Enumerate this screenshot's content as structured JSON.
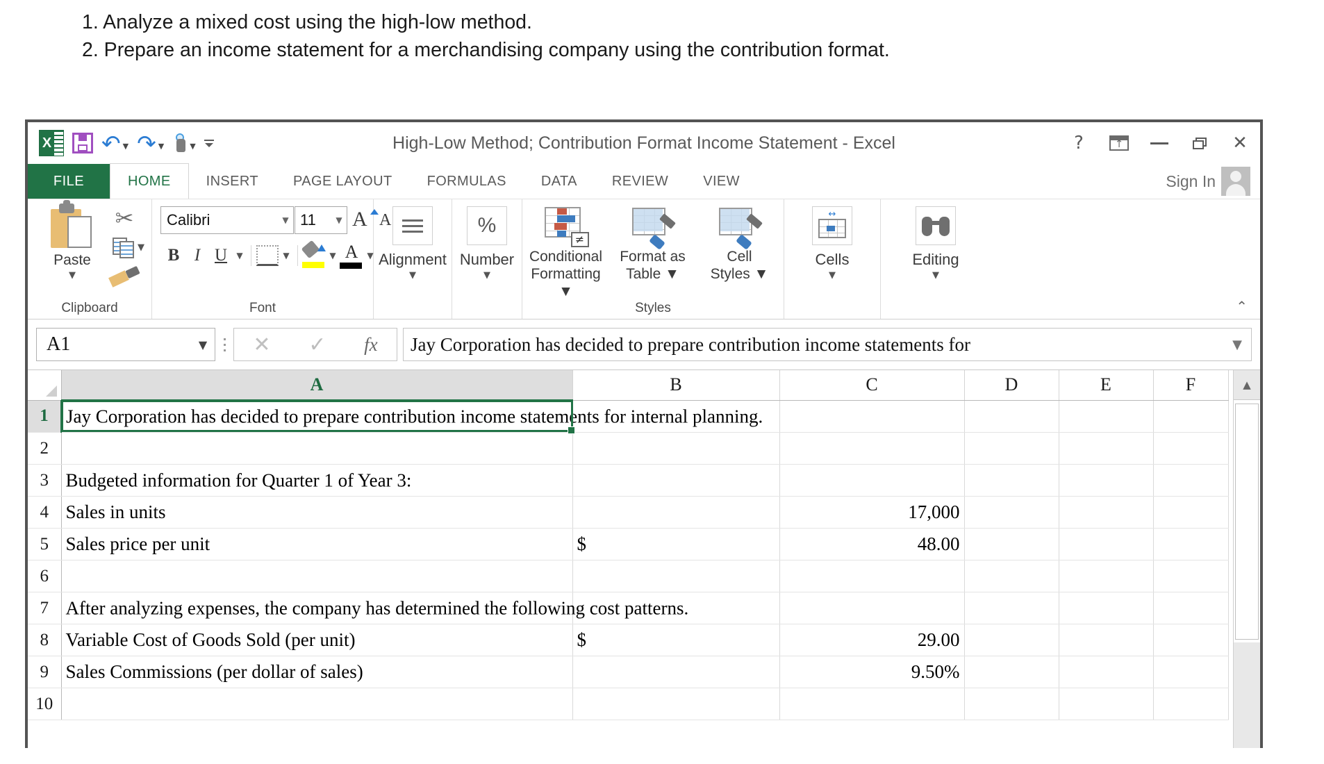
{
  "instructions": [
    "1. Analyze a mixed cost using the high-low method.",
    "2. Prepare an income statement for a merchandising company using the contribution format."
  ],
  "window": {
    "title": "High-Low Method; Contribution Format Income Statement - Excel",
    "quick_access": [
      {
        "name": "excel-logo",
        "label": "X"
      },
      {
        "name": "save",
        "label": "Save"
      },
      {
        "name": "undo",
        "label": "Undo"
      },
      {
        "name": "redo",
        "label": "Redo"
      },
      {
        "name": "touch-mode",
        "label": "Touch/Mouse Mode"
      },
      {
        "name": "customize-qat",
        "label": "Customize Quick Access Toolbar"
      }
    ],
    "controls": {
      "help": "?",
      "ribbon_display": "Ribbon Display Options",
      "minimize": "Minimize",
      "restore": "Restore Down",
      "close": "✕"
    },
    "sign_in": "Sign In"
  },
  "ribbon": {
    "file_tab": "FILE",
    "tabs": [
      {
        "label": "HOME",
        "active": true
      },
      {
        "label": "INSERT",
        "active": false
      },
      {
        "label": "PAGE LAYOUT",
        "active": false
      },
      {
        "label": "FORMULAS",
        "active": false
      },
      {
        "label": "DATA",
        "active": false
      },
      {
        "label": "REVIEW",
        "active": false
      },
      {
        "label": "VIEW",
        "active": false
      }
    ],
    "clipboard": {
      "group_label": "Clipboard",
      "paste_label": "Paste",
      "cut_label": "Cut",
      "copy_label": "Copy",
      "format_painter_label": "Format Painter"
    },
    "font": {
      "group_label": "Font",
      "font_name": "Calibri",
      "font_size": "11",
      "grow_font": "A",
      "shrink_font": "A",
      "bold": "B",
      "italic": "I",
      "underline": "U",
      "borders_label": "Borders",
      "fill_color_label": "Fill Color",
      "font_color_label": "Font Color"
    },
    "alignment": {
      "group_label": "Alignment"
    },
    "number": {
      "group_label": "Number",
      "symbol": "%"
    },
    "styles": {
      "group_label": "Styles",
      "conditional_formatting": "Conditional\nFormatting",
      "conditional_formatting_l1": "Conditional",
      "conditional_formatting_l2": "Formatting",
      "format_as_table_l1": "Format as",
      "format_as_table_l2": "Table",
      "cell_styles_l1": "Cell",
      "cell_styles_l2": "Styles",
      "neq_glyph": "≠"
    },
    "cells": {
      "group_label": "Cells"
    },
    "editing": {
      "group_label": "Editing"
    },
    "collapse": "⌃"
  },
  "formula_bar": {
    "name_box": "A1",
    "cancel": "✕",
    "enter": "✓",
    "insert_function": "fx",
    "value": "Jay Corporation  has decided to prepare contribution income statements for",
    "expand": "⌵"
  },
  "sheet": {
    "columns": [
      "A",
      "B",
      "C",
      "D",
      "E",
      "F"
    ],
    "selected_column": "A",
    "selected_row": 1,
    "selected_cell": "A1",
    "rows": [
      {
        "n": "1",
        "a": "Jay Corporation  has decided to prepare contribution income statements for internal planning.",
        "b": "",
        "c": "",
        "d": "",
        "e": "",
        "f": "",
        "style": "spill"
      },
      {
        "n": "2",
        "a": "",
        "b": "",
        "c": "",
        "d": "",
        "e": "",
        "f": "",
        "style": "plain"
      },
      {
        "n": "3",
        "a": "Budgeted information for Quarter 1 of Year 3:",
        "b": "",
        "c": "",
        "d": "",
        "e": "",
        "f": "",
        "style": "spill"
      },
      {
        "n": "4",
        "a": "Sales in units",
        "b": "",
        "c": "17,000",
        "d": "",
        "e": "",
        "f": "",
        "style": "indent"
      },
      {
        "n": "5",
        "a": "Sales price per unit",
        "b": "$",
        "c": "48.00",
        "d": "",
        "e": "",
        "f": "",
        "style": "indent"
      },
      {
        "n": "6",
        "a": "",
        "b": "",
        "c": "",
        "d": "",
        "e": "",
        "f": "",
        "style": "plain"
      },
      {
        "n": "7",
        "a": "After analyzing expenses, the company has determined the following cost patterns.",
        "b": "",
        "c": "",
        "d": "",
        "e": "",
        "f": "",
        "style": "spill"
      },
      {
        "n": "8",
        "a": "Variable Cost of Goods Sold (per unit)",
        "b": "$",
        "c": "29.00",
        "d": "",
        "e": "",
        "f": "",
        "style": "indent"
      },
      {
        "n": "9",
        "a": "Sales Commissions (per dollar of sales)",
        "b": "",
        "c": "9.50%",
        "d": "",
        "e": "",
        "f": "",
        "style": "indent"
      },
      {
        "n": "10",
        "a": "",
        "b": "",
        "c": "",
        "d": "",
        "e": "",
        "f": "",
        "style": "plain"
      }
    ]
  },
  "colors": {
    "excel_green": "#217346",
    "selection_green": "#217346",
    "header_gray": "#dedede",
    "window_border": "#545454"
  }
}
